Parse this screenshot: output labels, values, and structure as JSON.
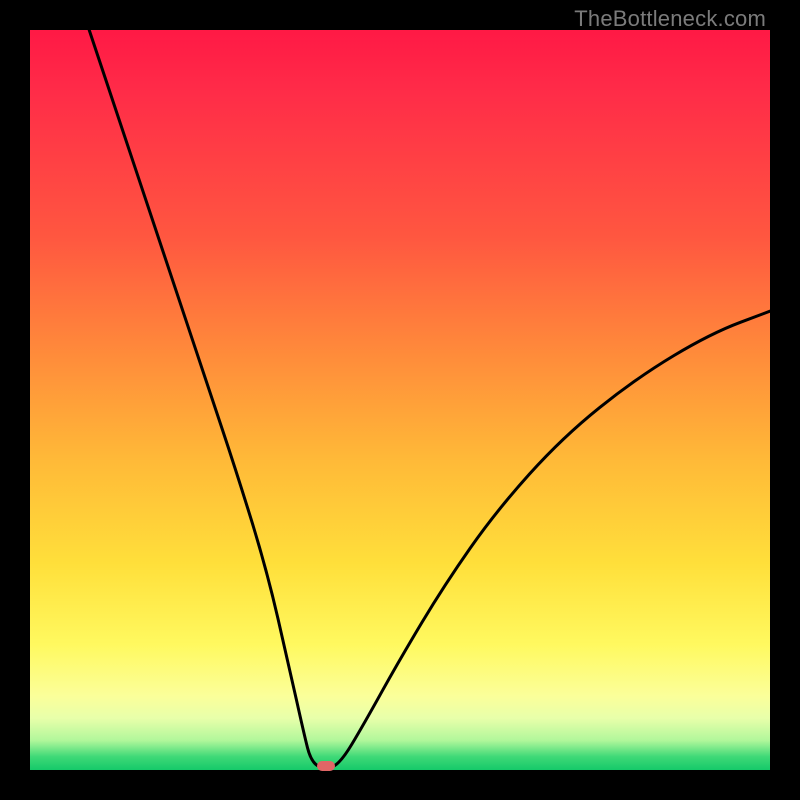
{
  "watermark": "TheBottleneck.com",
  "colors": {
    "frame": "#000000",
    "curve": "#000000",
    "marker": "#e06666",
    "gradient_stops": [
      "#ff1945",
      "#ff5740",
      "#ff8f3a",
      "#ffb938",
      "#ffdf3a",
      "#fff95f",
      "#fbff9a",
      "#e8ffaa",
      "#b1f79b",
      "#3fd977",
      "#15c96a"
    ]
  },
  "chart_data": {
    "type": "line",
    "title": "",
    "xlabel": "",
    "ylabel": "",
    "xlim": [
      0,
      100
    ],
    "ylim": [
      0,
      100
    ],
    "grid": false,
    "notes": "V-shaped bottleneck curve. X axis implied hardware balance, Y axis implied bottleneck %. Minimum at x≈40. Left branch starts near (8,100), right branch reaches ≈(100,62). Values estimated from pixels.",
    "marker": {
      "x": 40,
      "y": 0
    },
    "series": [
      {
        "name": "bottleneck-curve",
        "points": [
          {
            "x": 8,
            "y": 100
          },
          {
            "x": 12,
            "y": 88
          },
          {
            "x": 16,
            "y": 76
          },
          {
            "x": 20,
            "y": 64
          },
          {
            "x": 24,
            "y": 52
          },
          {
            "x": 28,
            "y": 40
          },
          {
            "x": 32,
            "y": 27
          },
          {
            "x": 35,
            "y": 14
          },
          {
            "x": 37,
            "y": 5
          },
          {
            "x": 38,
            "y": 1
          },
          {
            "x": 40,
            "y": 0
          },
          {
            "x": 42,
            "y": 1
          },
          {
            "x": 45,
            "y": 6
          },
          {
            "x": 50,
            "y": 15
          },
          {
            "x": 56,
            "y": 25
          },
          {
            "x": 63,
            "y": 35
          },
          {
            "x": 72,
            "y": 45
          },
          {
            "x": 82,
            "y": 53
          },
          {
            "x": 92,
            "y": 59
          },
          {
            "x": 100,
            "y": 62
          }
        ]
      }
    ]
  }
}
